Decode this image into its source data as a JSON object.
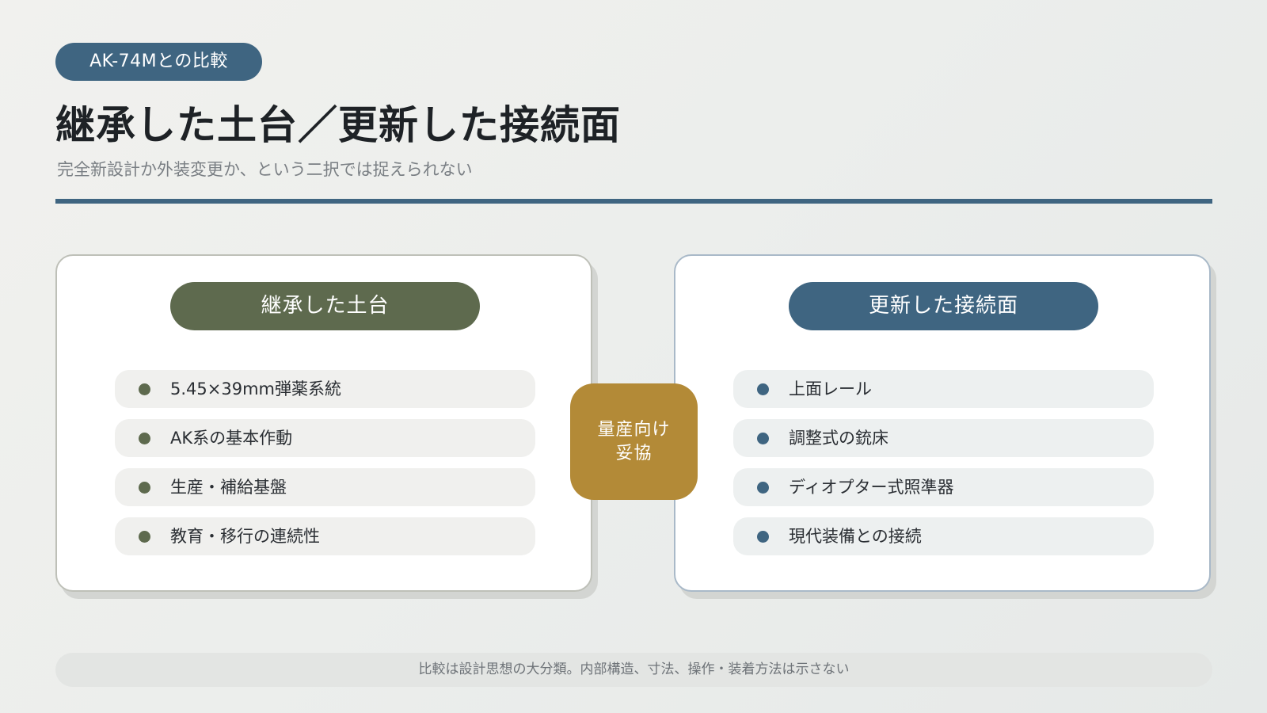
{
  "tag": "AK-74Mとの比較",
  "title": "継承した土台／更新した接続面",
  "subtitle": "完全新設計か外装変更か、という二択では捉えられない",
  "colors": {
    "accent_blue": "#3f6581",
    "accent_olive": "#5e6a4e",
    "accent_gold": "#b38a37"
  },
  "left_panel": {
    "header": "継承した土台",
    "items": [
      "5.45×39mm弾薬系統",
      "AK系の基本作動",
      "生産・補給基盤",
      "教育・移行の連続性"
    ]
  },
  "center_badge": {
    "line1": "量産向け",
    "line2": "妥協"
  },
  "right_panel": {
    "header": "更新した接続面",
    "items": [
      "上面レール",
      "調整式の銃床",
      "ディオプター式照準器",
      "現代装備との接続"
    ]
  },
  "footer_note": "比較は設計思想の大分類。内部構造、寸法、操作・装着方法は示さない"
}
